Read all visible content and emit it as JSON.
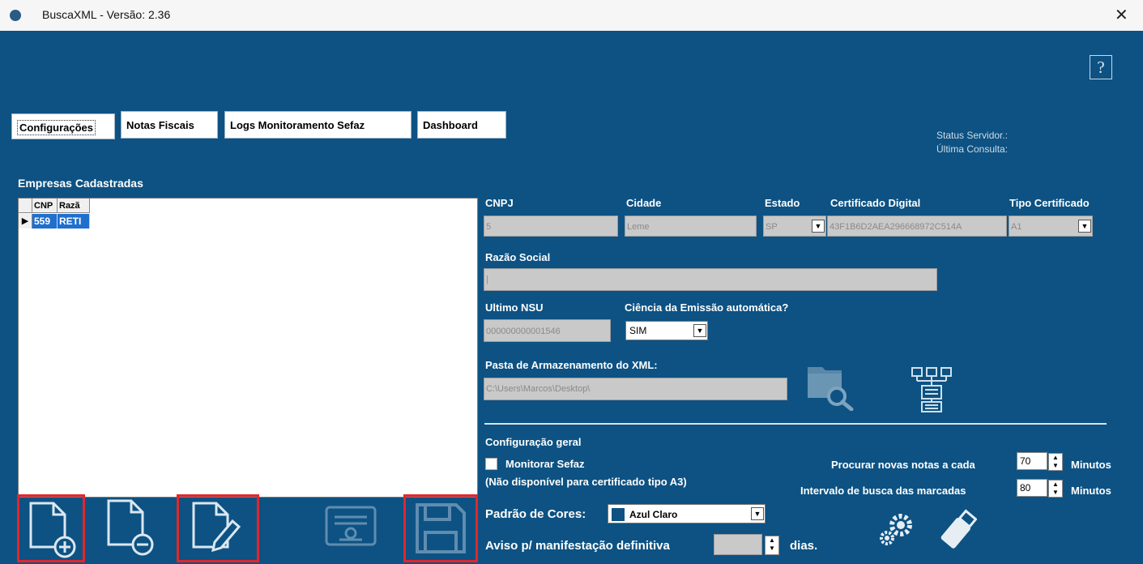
{
  "window": {
    "title": "BuscaXML - Versão: 2.36",
    "close_glyph": "✕",
    "help_glyph": "?"
  },
  "tabs": [
    {
      "label": "Configurações",
      "active": true
    },
    {
      "label": "Notas Fiscais",
      "active": false
    },
    {
      "label": "Logs Monitoramento Sefaz",
      "active": false
    },
    {
      "label": "Dashboard",
      "active": false
    }
  ],
  "status": {
    "server_label": "Status Servidor.:",
    "last_query_label": "Última Consulta:"
  },
  "companies": {
    "title": "Empresas Cadastradas",
    "columns": [
      "CNP",
      "Razã"
    ],
    "rows": [
      {
        "indicator": "▶",
        "cnpj": "559",
        "razao": "RETI"
      }
    ]
  },
  "form": {
    "cnpj": {
      "label": "CNPJ",
      "value": "5"
    },
    "cidade": {
      "label": "Cidade",
      "value": "Leme"
    },
    "estado": {
      "label": "Estado",
      "value": "SP"
    },
    "certificado": {
      "label": "Certificado Digital",
      "value": "43F1B6D2AEA296668972C514A"
    },
    "tipo_cert": {
      "label": "Tipo Certificado",
      "value": "A1"
    },
    "razao_social": {
      "label": "Razão Social",
      "value": "|"
    },
    "ultimo_nsu": {
      "label": "Ultimo NSU",
      "value": "000000000001546"
    },
    "ciencia": {
      "label": "Ciência da Emissão automática?",
      "value": "SIM"
    },
    "pasta": {
      "label": "Pasta de Armazenamento do XML:",
      "value": "C:\\Users\\Marcos\\Desktop\\"
    }
  },
  "config_geral": {
    "title": "Configuração geral",
    "monitorar_label": "Monitorar Sefaz",
    "monitorar_checked": false,
    "nota_a3": "(Não disponível para certificado tipo A3)",
    "procurar_label": "Procurar novas notas a cada",
    "procurar_value": "70",
    "intervalo_label": "Intervalo de busca das marcadas",
    "intervalo_value": "80",
    "minutos_label": "Minutos",
    "cores_label": "Padrão de Cores:",
    "cores_value": "Azul Claro",
    "cores_swatch": "#0d5283",
    "aviso_label": "Aviso p/ manifestação definitiva",
    "aviso_value": "",
    "dias_label": "dias."
  },
  "toolbar": {
    "add_icon": "add-document-icon",
    "remove_icon": "remove-document-icon",
    "edit_icon": "edit-document-icon",
    "cert_icon": "certificate-icon",
    "save_icon": "save-floppy-icon"
  },
  "colors": {
    "background": "#0d5283",
    "highlight": "#e3262b",
    "selection": "#1f6fce"
  }
}
